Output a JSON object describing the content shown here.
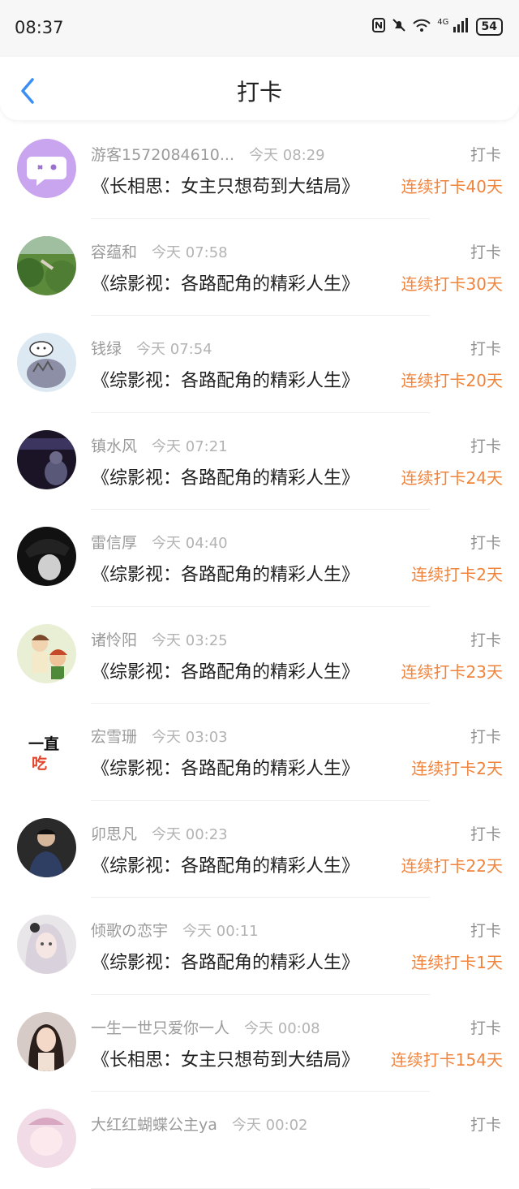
{
  "status_bar": {
    "time": "08:37",
    "network": "4G",
    "battery": "54"
  },
  "header": {
    "title": "打卡"
  },
  "rows": [
    {
      "user": "游客1572084610...",
      "time": "今天 08:29",
      "action": "打卡",
      "book": "《长相思：女主只想苟到大结局》",
      "streak": "连续打卡40天",
      "avatar": "ghost-avatar"
    },
    {
      "user": "容蕴和",
      "time": "今天 07:58",
      "action": "打卡",
      "book": "《综影视：各路配角的精彩人生》",
      "streak": "连续打卡30天",
      "avatar": "nature-avatar"
    },
    {
      "user": "钱绿",
      "time": "今天 07:54",
      "action": "打卡",
      "book": "《综影视：各路配角的精彩人生》",
      "streak": "连续打卡20天",
      "avatar": "anime-avatar"
    },
    {
      "user": "镇水风",
      "time": "今天 07:21",
      "action": "打卡",
      "book": "《综影视：各路配角的精彩人生》",
      "streak": "连续打卡24天",
      "avatar": "night-avatar"
    },
    {
      "user": "雷信厚",
      "time": "今天 04:40",
      "action": "打卡",
      "book": "《综影视：各路配角的精彩人生》",
      "streak": "连续打卡2天",
      "avatar": "portrait-avatar"
    },
    {
      "user": "诸怜阳",
      "time": "今天 03:25",
      "action": "打卡",
      "book": "《综影视：各路配角的精彩人生》",
      "streak": "连续打卡23天",
      "avatar": "illustration-avatar"
    },
    {
      "user": "宏雪珊",
      "time": "今天 03:03",
      "action": "打卡",
      "book": "《综影视：各路配角的精彩人生》",
      "streak": "连续打卡2天",
      "avatar": "text-avatar",
      "avatar_text": [
        "一直",
        "吃"
      ]
    },
    {
      "user": "卯思凡",
      "time": "今天 00:23",
      "action": "打卡",
      "book": "《综影视：各路配角的精彩人生》",
      "streak": "连续打卡22天",
      "avatar": "photo-avatar"
    },
    {
      "user": "倾歌の恋宇",
      "time": "今天 00:11",
      "action": "打卡",
      "book": "《综影视：各路配角的精彩人生》",
      "streak": "连续打卡1天",
      "avatar": "doll-avatar"
    },
    {
      "user": "一生一世只爱你一人",
      "time": "今天 00:08",
      "action": "打卡",
      "book": "《长相思：女主只想苟到大结局》",
      "streak": "连续打卡154天",
      "avatar": "woman-avatar"
    },
    {
      "user": "大红红蝴蝶公主ya",
      "time": "今天 00:02",
      "action": "打卡",
      "book": "",
      "streak": "",
      "avatar": "partial-avatar"
    }
  ],
  "colors": {
    "accent": "#3b8ef3",
    "streak": "#f1843d",
    "meta": "#9b9b9b"
  }
}
